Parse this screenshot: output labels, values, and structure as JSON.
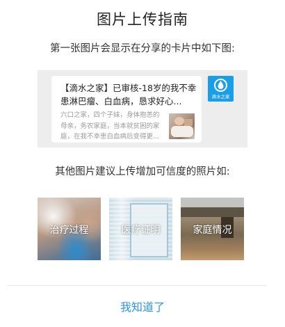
{
  "dialog": {
    "title": "图片上传指南",
    "subtitle_first": "第一张图片会显示在分享的卡片中如下图:",
    "share_card": {
      "title": "【滴水之家】已审核-18岁的我不幸患淋巴瘤、白血病，恳求好心...",
      "description": "六口之家，四个子妹，身体抱恙的母亲，务农家庭，当本就贫困的家庭，在我不幸患白血病后变得更...",
      "app_logo_text": "滴水之家"
    },
    "subtitle_other": "其他图片建议上传增加可信度的照片如:",
    "photos": [
      {
        "label": "治疗过程"
      },
      {
        "label": "医疗证明"
      },
      {
        "label": "家庭情况"
      }
    ],
    "confirm_label": "我知道了",
    "colors": {
      "accent": "#2b95e9",
      "logo_bg": "#1a9ee8",
      "preview_bg": "#ededed"
    }
  }
}
